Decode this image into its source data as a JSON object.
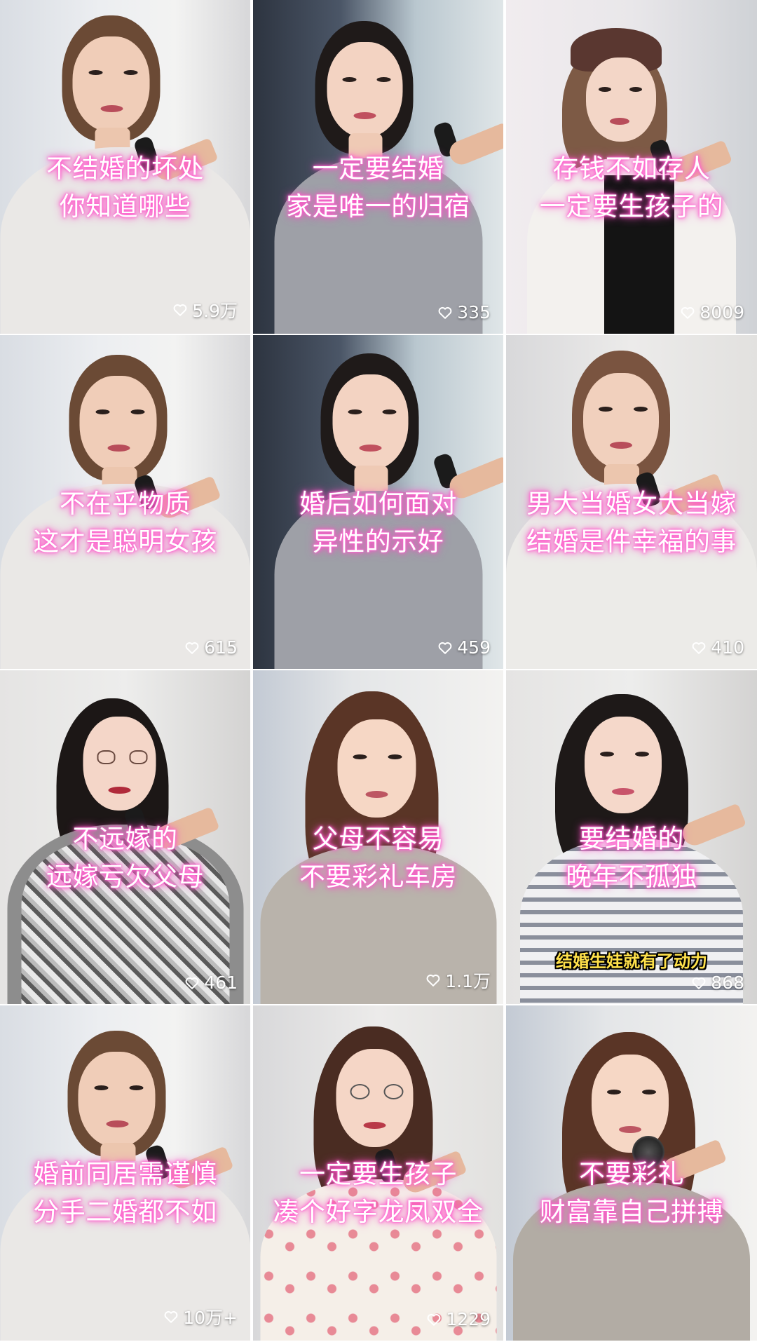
{
  "tiles": [
    {
      "lines": [
        "不结婚的坏处",
        "你知道哪些"
      ],
      "likes": "5.9万",
      "sub": ""
    },
    {
      "lines": [
        "一定要结婚",
        "家是唯一的归宿"
      ],
      "likes": "335",
      "sub": ""
    },
    {
      "lines": [
        "存钱不如存人",
        "一定要生孩子的"
      ],
      "likes": "8009",
      "sub": ""
    },
    {
      "lines": [
        "不在乎物质",
        "这才是聪明女孩"
      ],
      "likes": "615",
      "sub": ""
    },
    {
      "lines": [
        "婚后如何面对",
        "异性的示好"
      ],
      "likes": "459",
      "sub": ""
    },
    {
      "lines": [
        "男大当婚女大当嫁",
        "结婚是件幸福的事"
      ],
      "likes": "410",
      "sub": ""
    },
    {
      "lines": [
        "不远嫁的",
        "远嫁亏欠父母"
      ],
      "likes": "461",
      "sub": ""
    },
    {
      "lines": [
        "父母不容易",
        "不要彩礼车房"
      ],
      "likes": "1.1万",
      "sub": ""
    },
    {
      "lines": [
        "要结婚的",
        "晚年不孤独"
      ],
      "likes": "868",
      "sub": "结婚生娃就有了动力"
    },
    {
      "lines": [
        "婚前同居需谨慎",
        "分手二婚都不如"
      ],
      "likes": "10万+",
      "sub": ""
    },
    {
      "lines": [
        "一定要生孩子",
        "凑个好字龙凤双全"
      ],
      "likes": "1229",
      "sub": ""
    },
    {
      "lines": [
        "不要彩礼",
        "财富靠自己拼搏"
      ],
      "likes": "",
      "sub": ""
    }
  ],
  "icons": {
    "like": "heart-outline-icon"
  },
  "colors": {
    "caption_glow": "#ff4fc6",
    "caption_text": "#ffffff",
    "subcaption_text": "#ffe14a",
    "likes_text": "#ffffff"
  }
}
